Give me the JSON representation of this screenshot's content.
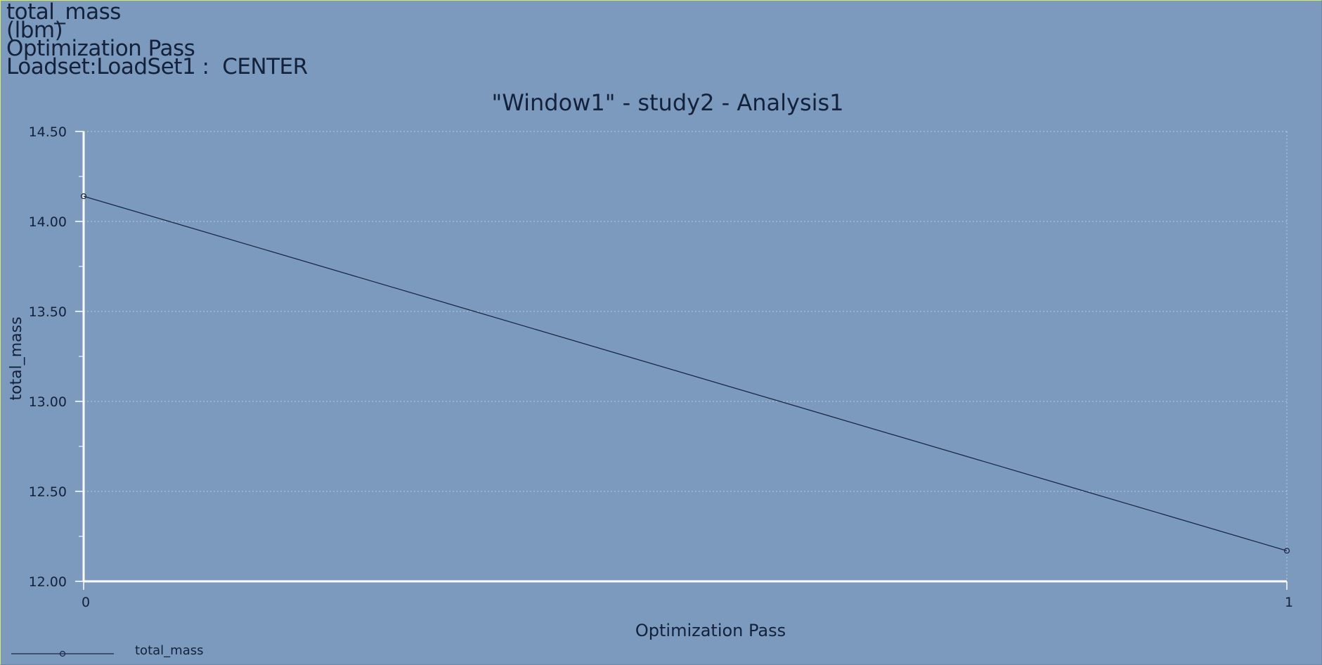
{
  "header": {
    "line1": "total_mass",
    "line2": "(lbm)",
    "line3": "Optimization Pass",
    "line4": "Loadset:LoadSet1 :  CENTER"
  },
  "colors": {
    "background": "#7b9abe",
    "axis": "#ffffff",
    "series": "#1b2747",
    "text": "#14213a",
    "grid": "#c9d6e6"
  },
  "chart_data": {
    "type": "line",
    "title": "\"Window1\" - study2 - Analysis1",
    "xlabel": "Optimization Pass",
    "ylabel": "total_mass",
    "xlim": [
      0,
      1
    ],
    "ylim": [
      12.0,
      14.5
    ],
    "x_ticks": [
      "0",
      "1"
    ],
    "y_ticks": [
      "12.00",
      "12.50",
      "13.00",
      "13.50",
      "14.00",
      "14.50"
    ],
    "grid": true,
    "legend_position": "bottom-left",
    "series": [
      {
        "name": "total_mass",
        "x": [
          0,
          1
        ],
        "y": [
          14.14,
          12.17
        ]
      }
    ]
  }
}
